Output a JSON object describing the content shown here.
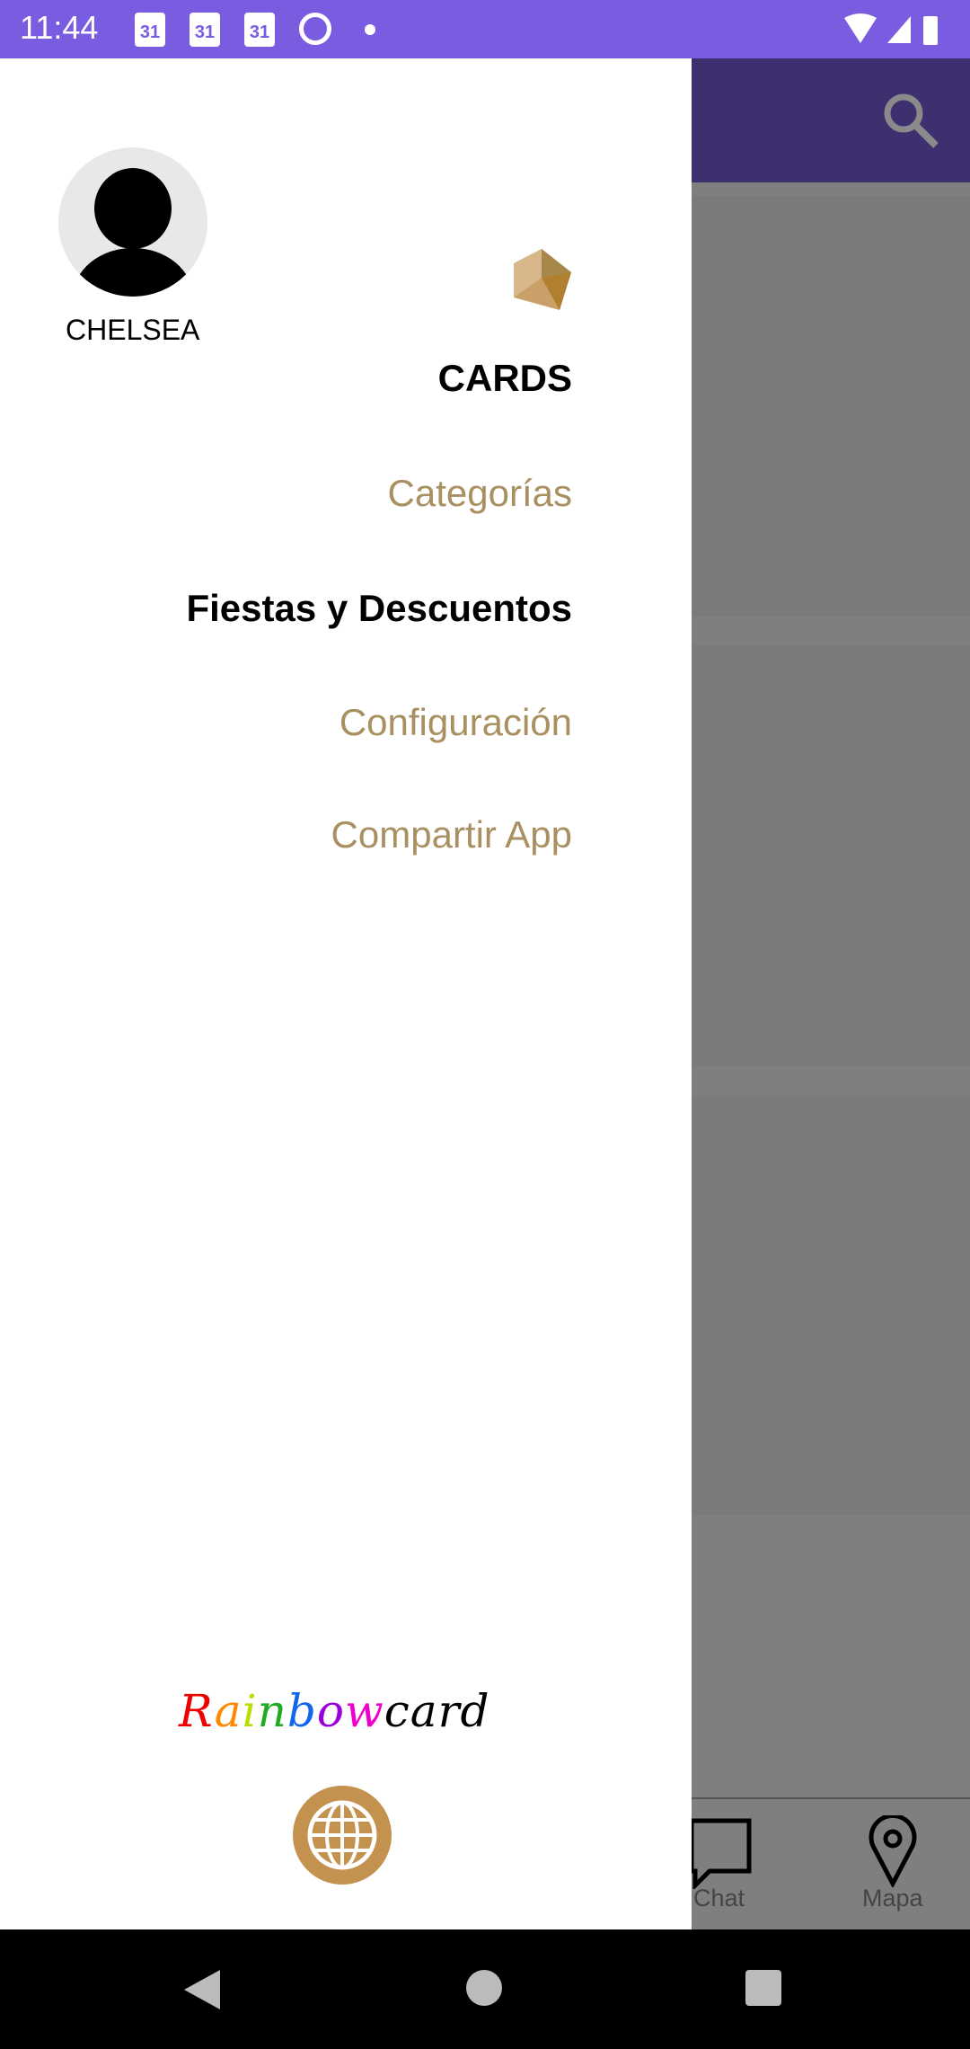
{
  "status_bar": {
    "time": "11:44",
    "calendar_day": "31",
    "icons": [
      "calendar-icon",
      "calendar-icon",
      "calendar-icon",
      "q-app-icon",
      "dot-icon",
      "wifi-icon",
      "signal-icon",
      "battery-icon"
    ]
  },
  "toolbar": {
    "search_icon": "search-icon"
  },
  "drawer": {
    "user_name": "CHELSEA",
    "brand_title": "CARDS",
    "menu": [
      {
        "label": "Categorías",
        "active": false
      },
      {
        "label": "Fiestas y Descuentos",
        "active": true
      },
      {
        "label": "Configuración",
        "active": false
      },
      {
        "label": "Compartir App",
        "active": false
      }
    ],
    "logo_text": "Rainbowcard",
    "colors": {
      "accent": "#a89060",
      "globe": "#c4924f"
    }
  },
  "bottom_nav": {
    "items": [
      {
        "label": "Chat",
        "icon": "chat-icon"
      },
      {
        "label": "Mapa",
        "icon": "map-pin-icon"
      }
    ]
  },
  "colors": {
    "status_bar": "#7a5ce0",
    "toolbar": "#3e2f6e"
  }
}
